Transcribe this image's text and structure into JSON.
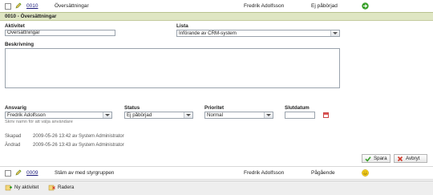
{
  "rows": [
    {
      "id": "0010",
      "name": "Översättningar",
      "owner": "Fredrik Adolfsson",
      "status": "Ej påbörjad",
      "status_icon": "go-arrow-icon",
      "status_color": "#3aa12b"
    },
    {
      "id": "0009",
      "name": "Stäm av med styrgruppen",
      "owner": "Fredrik Adolfsson",
      "status": "Pågående",
      "status_icon": "smiley-icon",
      "status_color": "#e0b800"
    }
  ],
  "panel": {
    "title": "0010 - Översättningar",
    "aktivitet_label": "Aktivitet",
    "aktivitet_value": "Översättningar",
    "lista_label": "Lista",
    "lista_value": "Införande av CRM-system",
    "beskrivning_label": "Beskrivning",
    "beskrivning_value": "",
    "ansvarig_label": "Ansvarig",
    "ansvarig_value": "Fredrik Adolfsson",
    "ansvarig_hint": "Skriv namn för att välja användare",
    "status_label": "Status",
    "status_value": "Ej påbörjad",
    "prioritet_label": "Prioritet",
    "prioritet_value": "Normal",
    "slutdatum_label": "Slutdatum",
    "slutdatum_value": "",
    "skapad_label": "Skapad",
    "skapad_value": "2009-05-26 13:42 av System Administrator",
    "andrad_label": "Ändrad",
    "andrad_value": "2009-05-26 13:43 av System Administrator",
    "save_label": "Spara",
    "cancel_label": "Avbryt"
  },
  "footer": {
    "new_label": "Ny aktivitet",
    "delete_label": "Radera"
  },
  "colors": {
    "panel_header_bg": "#dfe6c3",
    "save_icon": "#3aa12b",
    "cancel_icon": "#d23a2a"
  }
}
